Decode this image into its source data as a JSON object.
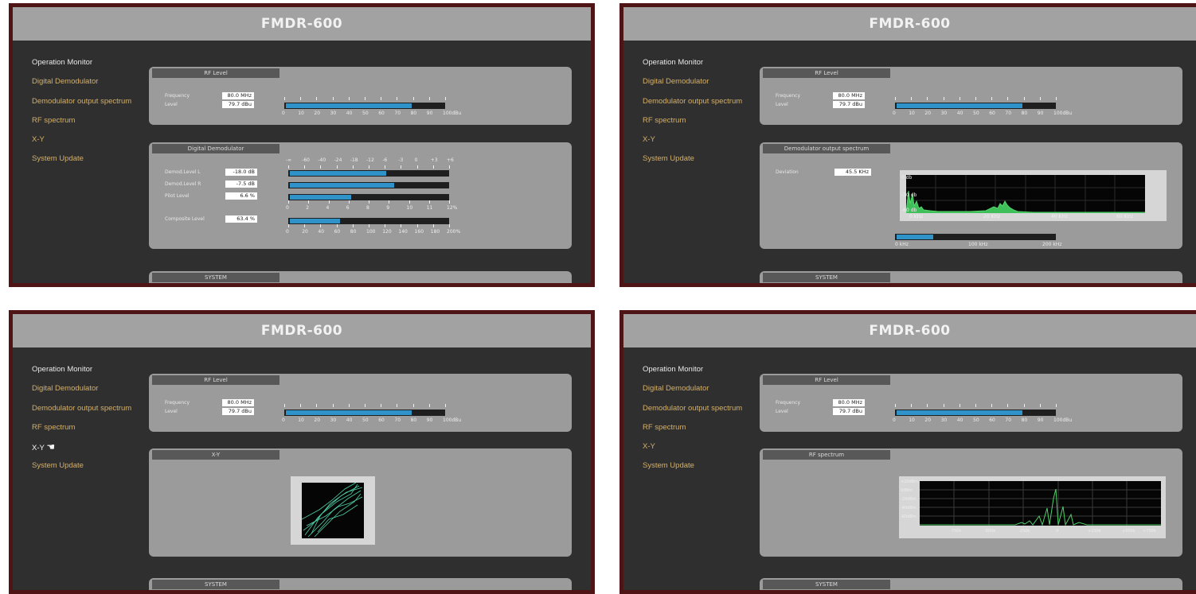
{
  "app_title": "FMDR-600",
  "nav": [
    "Operation Monitor",
    "Digital Demodulator",
    "Demodulator output spectrum",
    "RF spectrum",
    "X-Y",
    "System Update"
  ],
  "rf_level": {
    "title": "RF Level",
    "frequency_label": "Frequency",
    "level_label": "Level",
    "frequency_value": "80.0 MHz",
    "level_value": "79.7 dBu",
    "meter_fraction": 0.797,
    "scale": [
      "0",
      "10",
      "20",
      "30",
      "40",
      "50",
      "60",
      "70",
      "80",
      "90",
      "100dBu"
    ]
  },
  "digital_demodulator": {
    "title": "Digital Demodulator",
    "rows": [
      {
        "label": "Demod.Level L",
        "value": "-18.0 dB",
        "fraction": 0.61
      },
      {
        "label": "Demod.Level R",
        "value": "-7.5 dB",
        "fraction": 0.66
      },
      {
        "label": "Pilot Level",
        "value": "6.6 %",
        "fraction": 0.39
      },
      {
        "label": "Composite Level",
        "value": "63.4 %",
        "fraction": 0.32
      }
    ],
    "db_scale": [
      "-∞",
      "-60",
      "-40",
      "-24",
      "-18",
      "-12",
      "-6",
      "-3",
      "0",
      "+3",
      "+6"
    ],
    "pilot_scale": [
      "0",
      "2",
      "4",
      "6",
      "8",
      "9",
      "10",
      "11",
      "12%"
    ],
    "composite_scale": [
      "0",
      "20",
      "40",
      "60",
      "80",
      "100",
      "120",
      "140",
      "160",
      "180",
      "200%"
    ]
  },
  "demod_spectrum": {
    "title": "Demodulator output spectrum",
    "deviation_label": "Deviation",
    "deviation_value": "45.5 KHz",
    "y_labels": [
      "0 db",
      "-30 db",
      "-60 db"
    ],
    "x_labels": [
      "0 KHz",
      "20 KHz",
      "40 KHz",
      "60 KHz"
    ],
    "deviation_fraction": 0.23,
    "deviation_scale": [
      "0 kHz",
      "100 kHz",
      "200 kHz"
    ]
  },
  "xy": {
    "title": "X-Y"
  },
  "rf_spectrum": {
    "title": "RF spectrum",
    "y_labels": [
      "+20dBm",
      "0dBm",
      "-20dBm",
      "-40dBm",
      "-60dBm"
    ],
    "x_labels": [
      "-750k",
      "-500k",
      "-250k",
      "0",
      "+250k",
      "+500k",
      "+750k"
    ]
  },
  "system": {
    "title": "SYSTEM"
  },
  "colors": {
    "nav": "#d4b06a",
    "meter": "#2f93c9",
    "trace": "#53d66b",
    "frame": "#4e1416"
  }
}
